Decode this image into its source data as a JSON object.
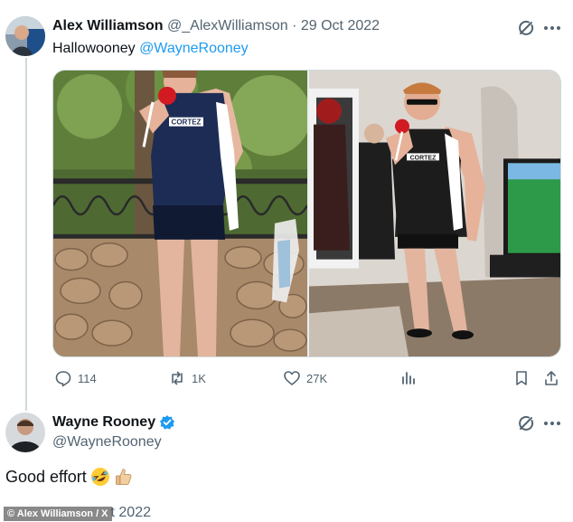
{
  "tweet1": {
    "author_name": "Alex Williamson",
    "author_handle": "@_AlexWilliamson",
    "separator": "·",
    "date": "29 Oct 2022",
    "text": "Hallowooney",
    "mention": "@WayneRooney",
    "left_photo_shirt_text": "CORTEZ",
    "right_photo_shirt_text": "CORTEZ",
    "stats": {
      "replies": "114",
      "reposts": "1K",
      "likes": "27K"
    }
  },
  "tweet2": {
    "author_name": "Wayne Rooney",
    "author_handle": "@WayneRooney",
    "text": "Good effort",
    "emoji": [
      "rolling-on-floor-laughing",
      "thumbs-up"
    ],
    "date_partial": "t 2022"
  },
  "credit": "© Alex Williamson / X",
  "colors": {
    "link": "#1d9bf0",
    "secondary_text": "#536471",
    "verified": "#1d9bf0",
    "divider": "#cfd9de"
  }
}
